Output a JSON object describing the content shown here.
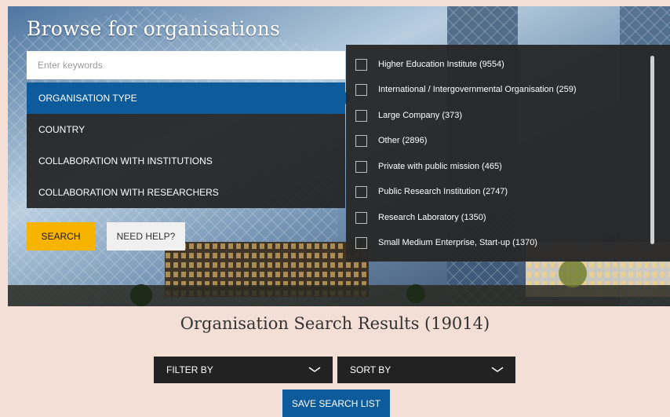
{
  "hero": {
    "title": "Browse for organisations",
    "search_placeholder": "Enter keywords"
  },
  "menu": {
    "items": [
      {
        "label": "ORGANISATION TYPE",
        "active": true
      },
      {
        "label": "COUNTRY",
        "active": false
      },
      {
        "label": "COLLABORATION WITH INSTITUTIONS",
        "active": false
      },
      {
        "label": "COLLABORATION WITH RESEARCHERS",
        "active": false
      }
    ]
  },
  "buttons": {
    "search": "SEARCH",
    "help": "NEED HELP?",
    "save": "SAVE SEARCH LIST"
  },
  "dropdown": {
    "options": [
      {
        "label": "Higher Education Institute (9554)",
        "checked": false
      },
      {
        "label": "International / Intergovernmental Organisation (259)",
        "checked": false
      },
      {
        "label": "Large Company (373)",
        "checked": false
      },
      {
        "label": "Other (2896)",
        "checked": false
      },
      {
        "label": "Private with public mission (465)",
        "checked": false
      },
      {
        "label": "Public Research Institution (2747)",
        "checked": false
      },
      {
        "label": "Research Laboratory (1350)",
        "checked": false
      },
      {
        "label": "Small Medium Enterprise, Start-up (1370)",
        "checked": false
      }
    ]
  },
  "results": {
    "title": "Organisation Search Results (19014)"
  },
  "filters": {
    "filter_by": "FILTER BY",
    "sort_by": "SORT BY"
  },
  "colors": {
    "accent_blue": "#0e5b9c",
    "search_yellow": "#f6b400",
    "page_bg": "#f3dfd6",
    "panel_dark": "#222222"
  }
}
